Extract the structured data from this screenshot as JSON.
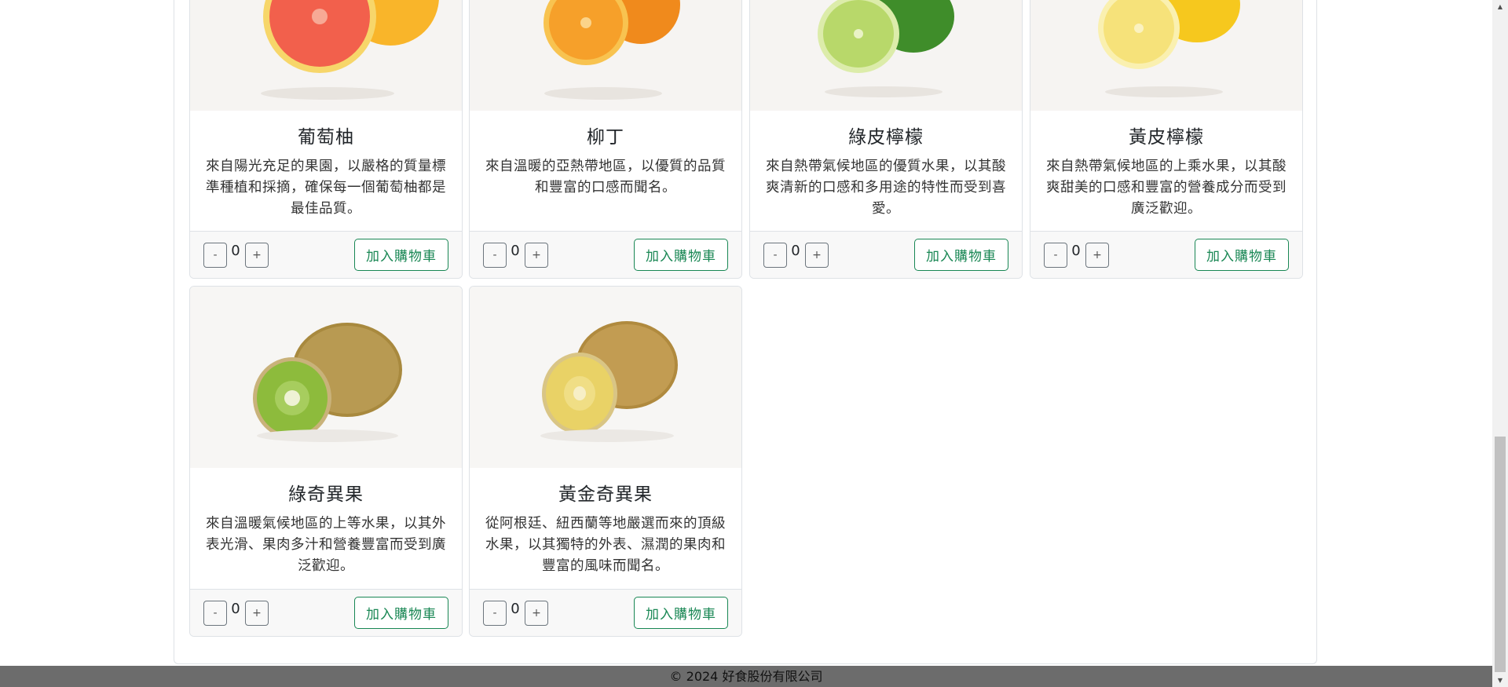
{
  "products": [
    {
      "name": "葡萄柚",
      "description": "來自陽光充足的果園，以嚴格的質量標準種植和採摘，確保每一個葡萄柚都是最佳品質。",
      "qty": "0",
      "image_icon": "grapefruit-image",
      "colors": {
        "flesh": "#f2604c",
        "rind": "#f9c23c",
        "whole": "#f5a623"
      }
    },
    {
      "name": "柳丁",
      "description": "來自溫暖的亞熱帶地區，以優質的品質和豐富的口感而聞名。",
      "qty": "0",
      "image_icon": "orange-image",
      "colors": {
        "flesh": "#f6a02a",
        "rind": "#f8c350",
        "whole": "#f08a1c"
      }
    },
    {
      "name": "綠皮檸檬",
      "description": "來自熱帶氣候地區的優質水果，以其酸爽清新的口感和多用途的特性而受到喜愛。",
      "qty": "0",
      "image_icon": "lime-image",
      "colors": {
        "flesh": "#b8d86a",
        "rind": "#dcecaa",
        "whole": "#3f8d2a"
      }
    },
    {
      "name": "黃皮檸檬",
      "description": "來自熱帶氣候地區的上乘水果，以其酸爽甜美的口感和豐富的營養成分而受到廣泛歡迎。",
      "qty": "0",
      "image_icon": "lemon-image",
      "colors": {
        "flesh": "#f6e27a",
        "rind": "#faf0b0",
        "whole": "#f6c81e"
      }
    },
    {
      "name": "綠奇異果",
      "description": "來自溫暖氣候地區的上等水果，以其外表光滑、果肉多汁和營養豐富而受到廣泛歡迎。",
      "qty": "0",
      "image_icon": "green-kiwi-image",
      "colors": {
        "flesh": "#8dbb3c",
        "rind": "#c9b27a",
        "whole": "#a8893e"
      }
    },
    {
      "name": "黃金奇異果",
      "description": "從阿根廷、紐西蘭等地嚴選而來的頂級水果，以其獨特的外表、濕潤的果肉和豐富的風味而聞名。",
      "qty": "0",
      "image_icon": "gold-kiwi-image",
      "colors": {
        "flesh": "#e9d266",
        "rind": "#d9c585",
        "whole": "#b08a3e"
      }
    }
  ],
  "buttons": {
    "minus": "-",
    "plus": "+",
    "add_to_cart": "加入購物車"
  },
  "footer": {
    "copyright": "© 2024 好食股份有限公司"
  },
  "colors": {
    "accent": "#198754",
    "footer_bg": "#6c6c6c"
  }
}
